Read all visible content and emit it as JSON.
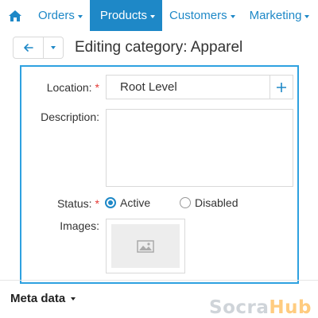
{
  "nav": {
    "items": [
      {
        "label": "Orders",
        "active": false
      },
      {
        "label": "Products",
        "active": true
      },
      {
        "label": "Customers",
        "active": false
      },
      {
        "label": "Marketing",
        "active": false
      }
    ]
  },
  "header": {
    "title": "Editing category: Apparel"
  },
  "form": {
    "location": {
      "label": "Location:",
      "required_mark": "*",
      "value": "Root Level"
    },
    "description": {
      "label": "Description:",
      "value": ""
    },
    "status": {
      "label": "Status:",
      "required_mark": "*",
      "options": [
        {
          "label": "Active",
          "checked": true
        },
        {
          "label": "Disabled",
          "checked": false
        }
      ]
    },
    "images": {
      "label": "Images:"
    }
  },
  "meta": {
    "label": "Meta data"
  },
  "watermark": {
    "part1": "Socra",
    "part2": "Hub"
  },
  "colors": {
    "accent": "#1e88c7",
    "panel_border": "#2ea1e0",
    "required": "#e53935"
  }
}
